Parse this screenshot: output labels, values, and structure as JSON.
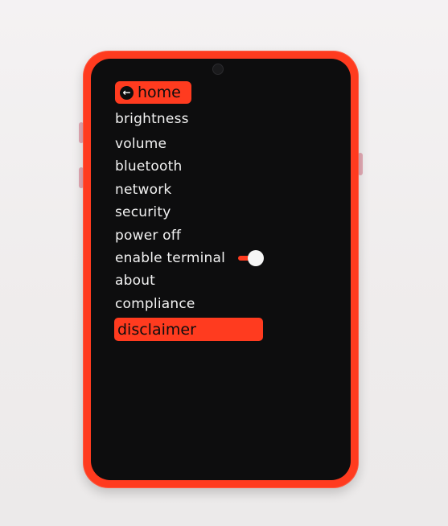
{
  "menu": {
    "home_icon": "arrow-left-icon",
    "home_label": "home",
    "items": [
      "brightness",
      "volume",
      "bluetooth",
      "network",
      "security",
      "power off",
      "enable terminal",
      "about",
      "compliance"
    ],
    "selected_label": "disclaimer",
    "enable_terminal_toggle": true
  },
  "colors": {
    "accent": "#ff3b1f",
    "screen_background": "#0d0d0e",
    "text": "#f2f2f2"
  }
}
